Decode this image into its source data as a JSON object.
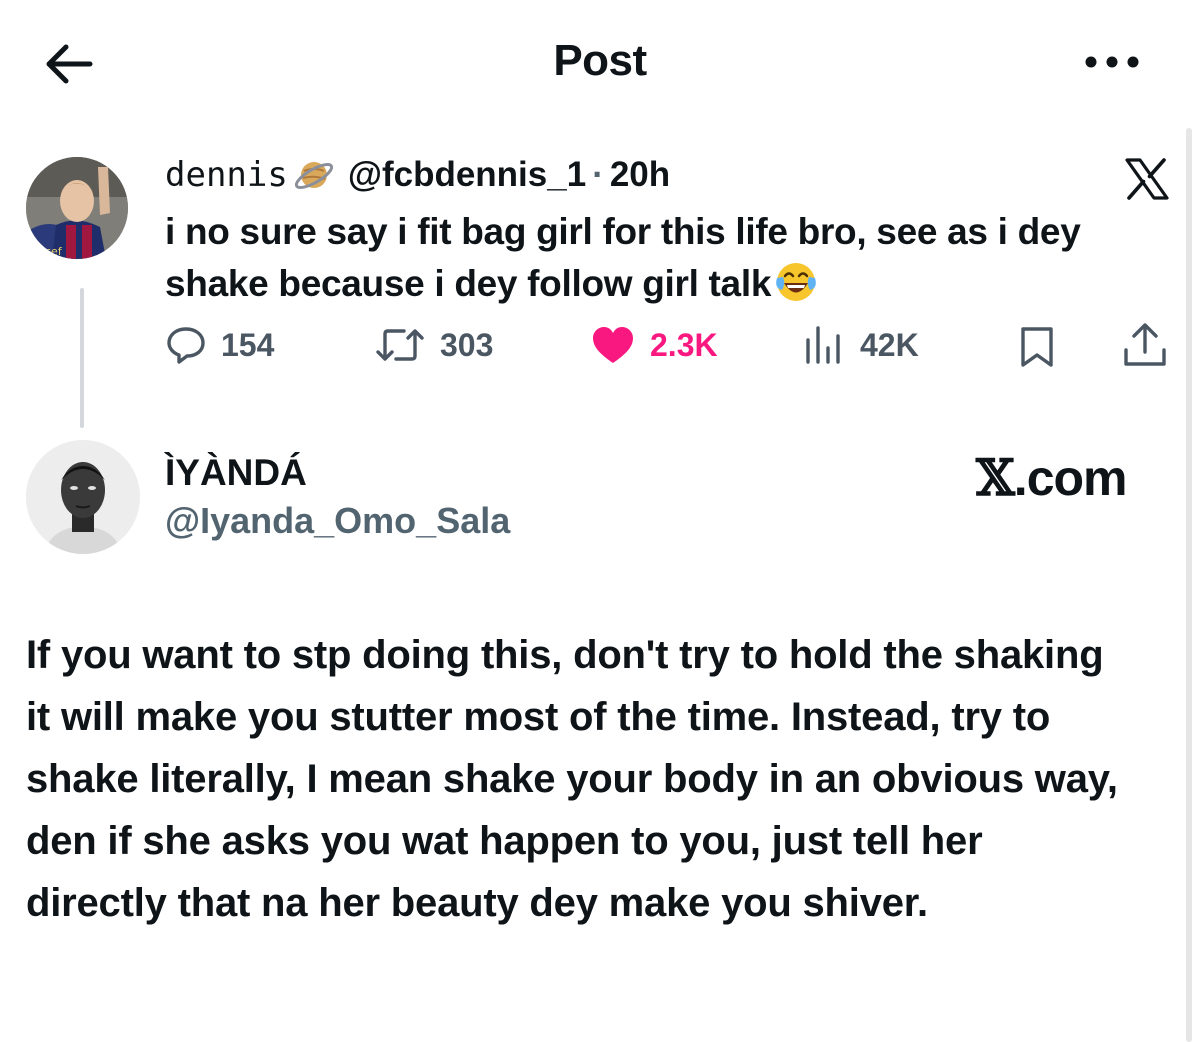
{
  "header": {
    "title": "Post",
    "back_icon": "arrow-left-icon",
    "more_icon": "more-horizontal-icon"
  },
  "parent_post": {
    "display_name": "dennis",
    "name_emoji": "ringed-planet-emoji",
    "handle": "@fcbdennis_1",
    "separator": "·",
    "time": "20h",
    "platform_icon": "x-logo-icon",
    "text": "i no sure say i fit bag girl for this life bro, see as i dey shake because i dey follow girl talk",
    "text_emoji": "face-with-tears-of-joy-emoji",
    "actions": {
      "replies": "154",
      "reposts": "303",
      "likes": "2.3K",
      "views": "42K"
    },
    "like_color": "#f91880"
  },
  "reply": {
    "display_name": "ÌYÀNDÁ",
    "handle": "@Iyanda_Omo_Sala",
    "watermark_x": "𝕏",
    "watermark_domain": ".com",
    "text": "If you want to stp doing this, don't try to hold the shaking it will make you stutter most of the time. Instead, try to shake literally, I mean shake your body in an obvious way, den if she asks you wat happen to you, just tell her directly that na her beauty dey make you shiver."
  }
}
